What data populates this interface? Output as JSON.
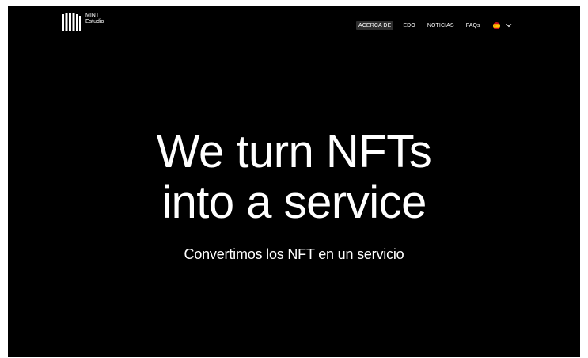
{
  "header": {
    "logo": {
      "line1": "MINT",
      "line2": "Estudio",
      "icon": "mint-logo-icon"
    },
    "nav": [
      {
        "label": "ACERCA DE",
        "active": true
      },
      {
        "label": "EDO",
        "active": false
      },
      {
        "label": "NOTICIAS",
        "active": false
      },
      {
        "label": "FAQs",
        "active": false
      }
    ],
    "language": {
      "icon": "spain-flag-icon",
      "dropdown_icon": "chevron-down-icon"
    }
  },
  "hero": {
    "title_line1": "We turn NFTs",
    "title_line2": "into a service",
    "subtitle": "Convertimos los NFT en un servicio"
  },
  "colors": {
    "background": "#000000",
    "text": "#ffffff",
    "active_nav_bg": "#2e2e2e",
    "flag_red": "#c60b1e",
    "flag_yellow": "#ffc400"
  }
}
